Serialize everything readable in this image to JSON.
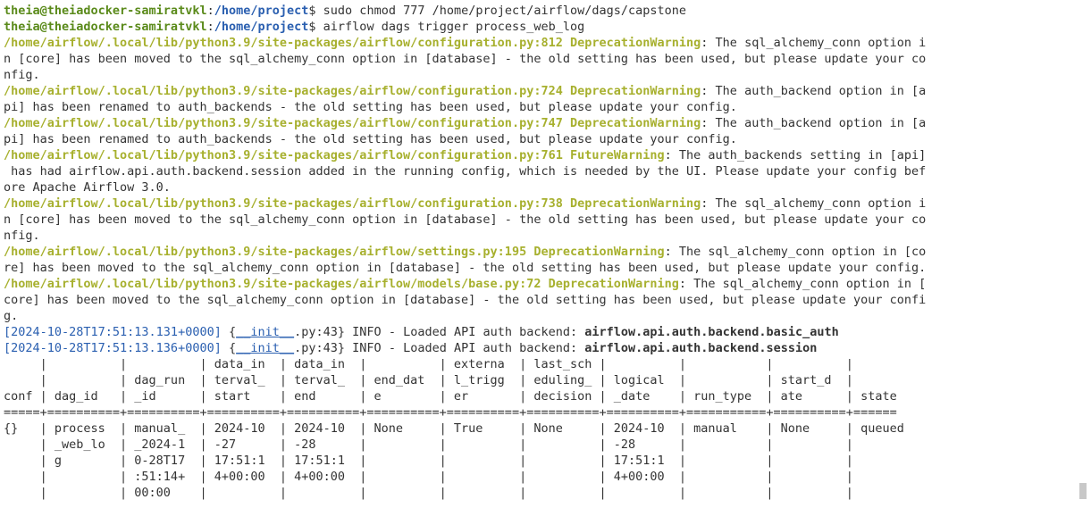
{
  "prompt": {
    "user": "theia@theiadocker-samiratvkl",
    "path": "/home/project",
    "symbol": "$"
  },
  "commands": [
    "sudo chmod 777 /home/project/airflow/dags/capstone",
    "airflow dags trigger process_web_log"
  ],
  "warnings": [
    {
      "path": "/home/airflow/.local/lib/python3.9/site-packages/airflow/configuration.py:812",
      "type": "DeprecationWarning",
      "first": ": The sql_alchemy_conn option i",
      "rest": [
        "n [core] has been moved to the sql_alchemy_conn option in [database] - the old setting has been used, but please update your co",
        "nfig."
      ]
    },
    {
      "path": "/home/airflow/.local/lib/python3.9/site-packages/airflow/configuration.py:724",
      "type": "DeprecationWarning",
      "first": ": The auth_backend option in [a",
      "rest": [
        "pi] has been renamed to auth_backends - the old setting has been used, but please update your config."
      ]
    },
    {
      "path": "/home/airflow/.local/lib/python3.9/site-packages/airflow/configuration.py:747",
      "type": "DeprecationWarning",
      "first": ": The auth_backend option in [a",
      "rest": [
        "pi] has been renamed to auth_backends - the old setting has been used, but please update your config."
      ]
    },
    {
      "path": "/home/airflow/.local/lib/python3.9/site-packages/airflow/configuration.py:761",
      "type": "FutureWarning",
      "first": ": The auth_backends setting in [api]",
      "rest": [
        " has had airflow.api.auth.backend.session added in the running config, which is needed by the UI. Please update your config bef",
        "ore Apache Airflow 3.0."
      ]
    },
    {
      "path": "/home/airflow/.local/lib/python3.9/site-packages/airflow/configuration.py:738",
      "type": "DeprecationWarning",
      "first": ": The sql_alchemy_conn option i",
      "rest": [
        "n [core] has been moved to the sql_alchemy_conn option in [database] - the old setting has been used, but please update your co",
        "nfig."
      ]
    },
    {
      "path": "/home/airflow/.local/lib/python3.9/site-packages/airflow/settings.py:195",
      "type": "DeprecationWarning",
      "first": ": The sql_alchemy_conn option in [co",
      "rest": [
        "re] has been moved to the sql_alchemy_conn option in [database] - the old setting has been used, but please update your config."
      ]
    },
    {
      "path": "/home/airflow/.local/lib/python3.9/site-packages/airflow/models/base.py:72",
      "type": "DeprecationWarning",
      "first": ": The sql_alchemy_conn option in [",
      "rest": [
        "core] has been moved to the sql_alchemy_conn option in [database] - the old setting has been used, but please update your confi",
        "g."
      ]
    }
  ],
  "info_lines": [
    {
      "timestamp": "[2024-10-28T17:51:13.131+0000]",
      "source_open": " {",
      "module": "__init__",
      "source_close": ".py:43}",
      "msg": " INFO - Loaded API auth backend: ",
      "value": "airflow.api.auth.backend.basic_auth"
    },
    {
      "timestamp": "[2024-10-28T17:51:13.136+0000]",
      "source_open": " {",
      "module": "__init__",
      "source_close": ".py:43}",
      "msg": " INFO - Loaded API auth backend: ",
      "value": "airflow.api.auth.backend.session"
    }
  ],
  "table": {
    "header_rows": [
      "     |          |          | data_in  | data_in  |          | externa  | last_sch |          |           |          |",
      "     |          | dag_run  | terval_  | terval_  | end_dat  | l_trigg  | eduling_ | logical  |           | start_d  |",
      "conf | dag_id   | _id      | start    | end      | e        | er       | decision | _date    | run_type  | ate      | state"
    ],
    "separator": "=====+==========+==========+==========+==========+==========+==========+==========+==========+===========+==========+======",
    "data_rows": [
      "{}   | process  | manual_  | 2024-10  | 2024-10  | None     | True     | None     | 2024-10  | manual    | None     | queued",
      "     | _web_lo  | _2024-1  | -27      | -28      |          |          |          | -28      |           |          |",
      "     | g        | 0-28T17  | 17:51:1  | 17:51:1  |          |          |          | 17:51:1  |           |          |",
      "     |          | :51:14+  | 4+00:00  | 4+00:00  |          |          |          | 4+00:00  |           |          |",
      "     |          | 00:00    |          |          |          |          |          |          |           |          |"
    ]
  }
}
